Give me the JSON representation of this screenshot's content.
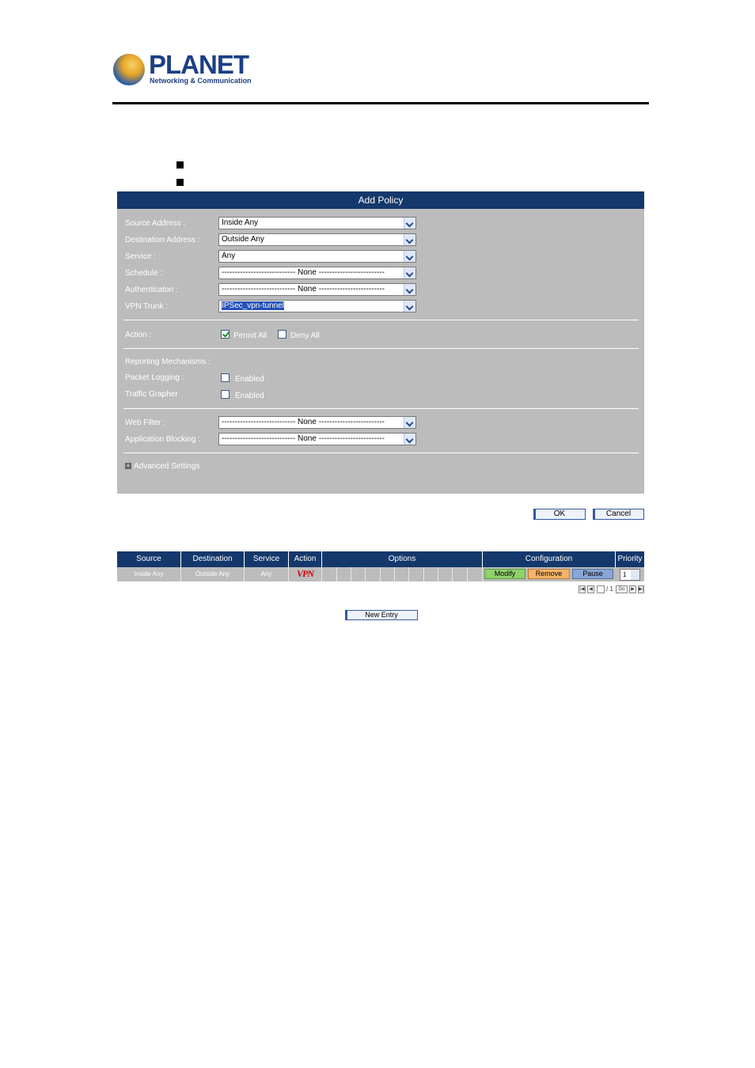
{
  "logo": {
    "brand": "PLANET",
    "tagline": "Networking & Communication"
  },
  "panel": {
    "title": "Add Policy",
    "fields": [
      {
        "label": "Source Address :",
        "value": "Inside Any"
      },
      {
        "label": "Destination Address :",
        "value": "Outside Any"
      },
      {
        "label": "Service :",
        "value": "Any"
      },
      {
        "label": "Schedule :",
        "value": "---------------------------- None -------------------------"
      },
      {
        "label": "Authenticaton :",
        "value": "---------------------------- None -------------------------"
      },
      {
        "label": "VPN Trunk :",
        "value": "IPSec_vpn-tunnel"
      }
    ],
    "action": {
      "label": "Action :",
      "permit": "Permit All",
      "deny": "Deny All",
      "selected": "Permit All"
    },
    "reporting": {
      "label": "Reporting Mechanisms :",
      "packet_logging": {
        "label": "Packet Logging :",
        "option": "Enabled"
      },
      "traffic_grapher": {
        "label": "Traffic Grapher",
        "option": "Enabled"
      }
    },
    "web_filter": {
      "label": "Web Filter :",
      "value": "---------------------------- None -------------------------"
    },
    "app_blocking": {
      "label": "Application Blocking :",
      "value": "---------------------------- None -------------------------"
    },
    "advanced": {
      "icon": "+",
      "label": "Advanced Settings"
    }
  },
  "buttons": {
    "ok": "OK",
    "cancel": "Cancel",
    "new_entry": "New Entry"
  },
  "table": {
    "headers": [
      "Source",
      "Destination",
      "Service",
      "Action",
      "Options",
      "Configuration",
      "Priority"
    ],
    "row": {
      "source": "Inside Any",
      "destination": "Outside Any",
      "service": "Any",
      "action": "VPN",
      "modify": "Modify",
      "remove": "Remove",
      "pause": "Pause",
      "priority": "1"
    },
    "pagination": {
      "page": "/ 1",
      "go": "Go"
    }
  },
  "colors": {
    "header_bg": "#14386b",
    "panel_bg": "#bcbcbc",
    "modify": "#8fd16b",
    "remove": "#f6b46b",
    "pause": "#8aa6d6"
  }
}
